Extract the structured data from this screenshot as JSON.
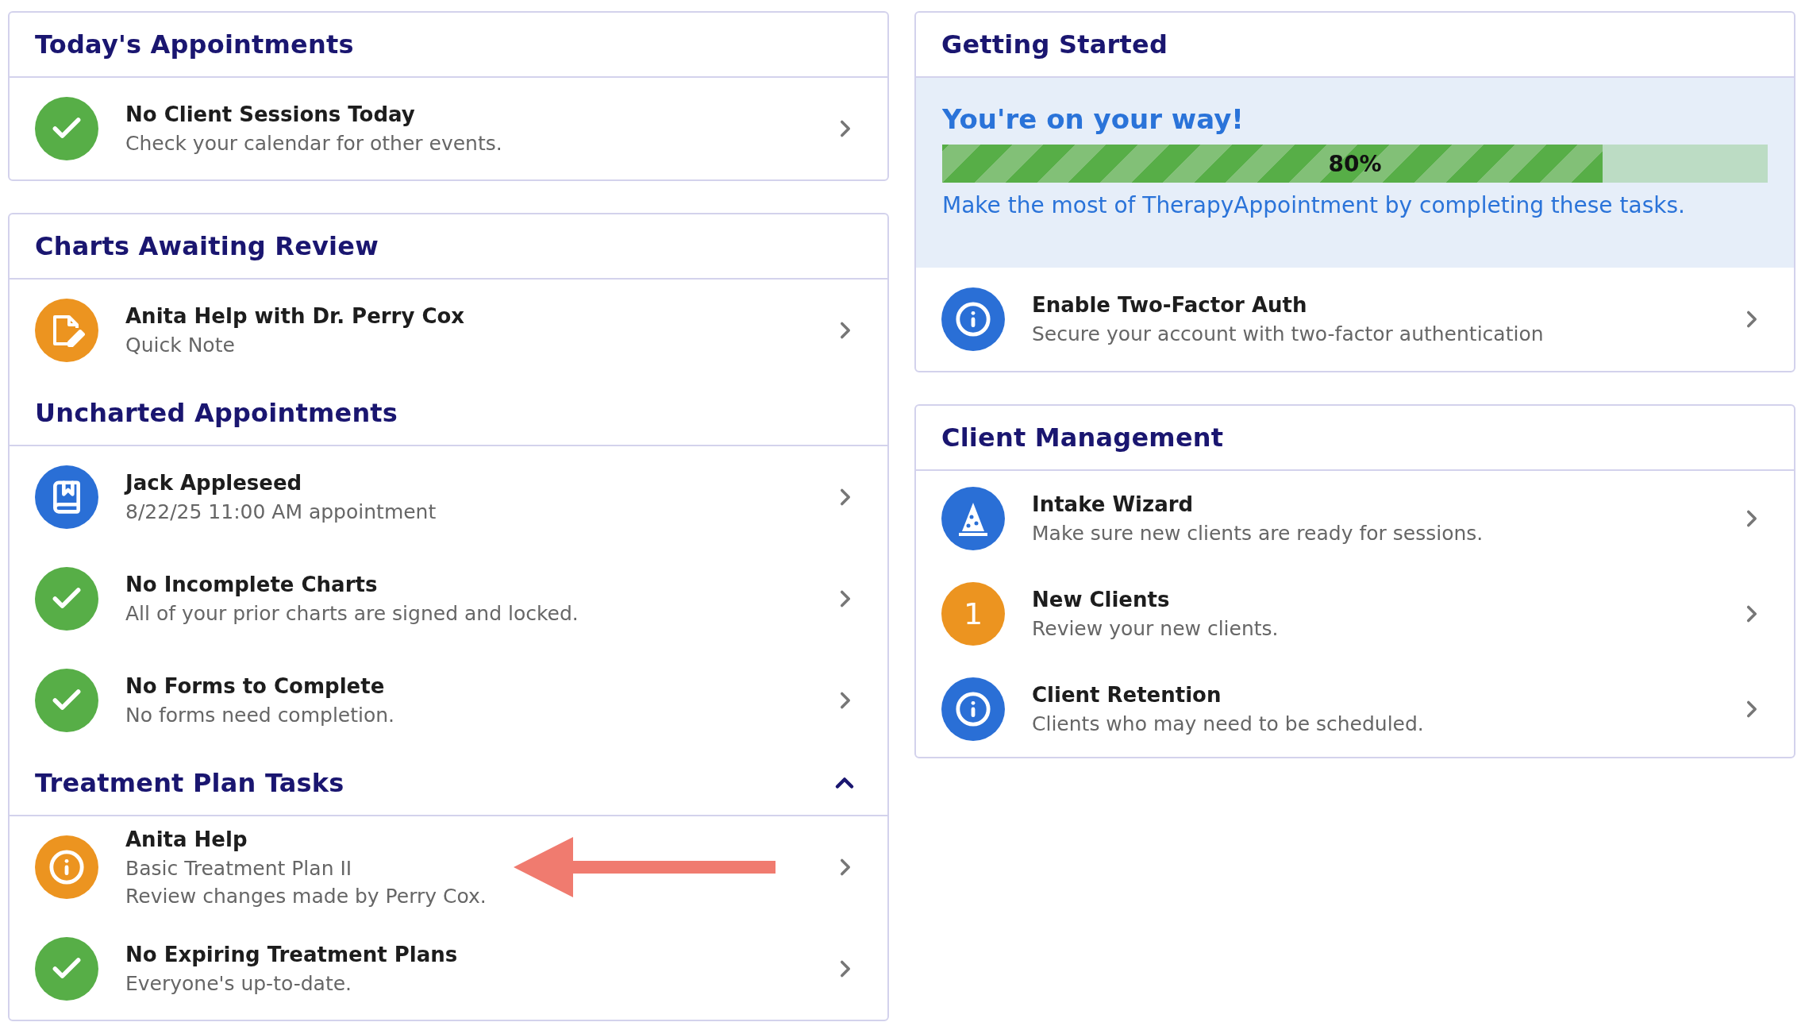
{
  "left": [
    {
      "sections": [
        {
          "title": "Today's Appointments",
          "items": [
            {
              "kind": "check",
              "color": "#57ae47",
              "title": "No Client Sessions Today",
              "lines": [
                "Check your calendar for other events."
              ]
            }
          ]
        }
      ]
    },
    {
      "sections": [
        {
          "title": "Charts Awaiting Review",
          "items": [
            {
              "kind": "note",
              "color": "#ec9420",
              "title": "Anita Help with Dr. Perry Cox",
              "lines": [
                "Quick Note"
              ]
            }
          ]
        },
        {
          "title": "Uncharted Appointments",
          "items": [
            {
              "kind": "notebook",
              "color": "#2a6fd6",
              "title": "Jack Appleseed",
              "lines": [
                "8/22/25 11:00 AM appointment"
              ]
            },
            {
              "kind": "check",
              "color": "#57ae47",
              "title": "No Incomplete Charts",
              "lines": [
                "All of your prior charts are signed and locked."
              ]
            },
            {
              "kind": "check",
              "color": "#57ae47",
              "title": "No Forms to Complete",
              "lines": [
                "No forms need completion."
              ]
            }
          ]
        },
        {
          "title": "Treatment Plan Tasks",
          "expanded": true,
          "items": [
            {
              "kind": "info",
              "color": "#ec9420",
              "title": "Anita Help",
              "lines": [
                "Basic Treatment Plan II",
                "Review changes made by Perry Cox."
              ],
              "annotated": true
            },
            {
              "kind": "check",
              "color": "#57ae47",
              "title": "No Expiring Treatment Plans",
              "lines": [
                "Everyone's up-to-date."
              ]
            }
          ]
        }
      ]
    }
  ],
  "right": [
    {
      "sections": [
        {
          "title": "Getting Started",
          "banner": {
            "heading": "You're on your way!",
            "level": 0.8,
            "label": "80%",
            "text": "Make the most of TherapyAppointment by completing these tasks."
          },
          "items": [
            {
              "kind": "info",
              "color": "#2a6fd6",
              "title": "Enable Two-Factor Auth",
              "lines": [
                "Secure your account with two-factor authentication"
              ]
            }
          ]
        }
      ]
    },
    {
      "sections": [
        {
          "title": "Client Management",
          "items": [
            {
              "kind": "wizard",
              "color": "#2a6fd6",
              "title": "Intake Wizard",
              "lines": [
                "Make sure new clients are ready for sessions."
              ]
            },
            {
              "kind": "count",
              "color": "#ec9420",
              "count": "1",
              "title": "New Clients",
              "lines": [
                "Review your new clients."
              ]
            },
            {
              "kind": "info",
              "color": "#2a6fd6",
              "title": "Client Retention",
              "lines": [
                "Clients who may need to be scheduled."
              ]
            }
          ]
        }
      ]
    }
  ]
}
